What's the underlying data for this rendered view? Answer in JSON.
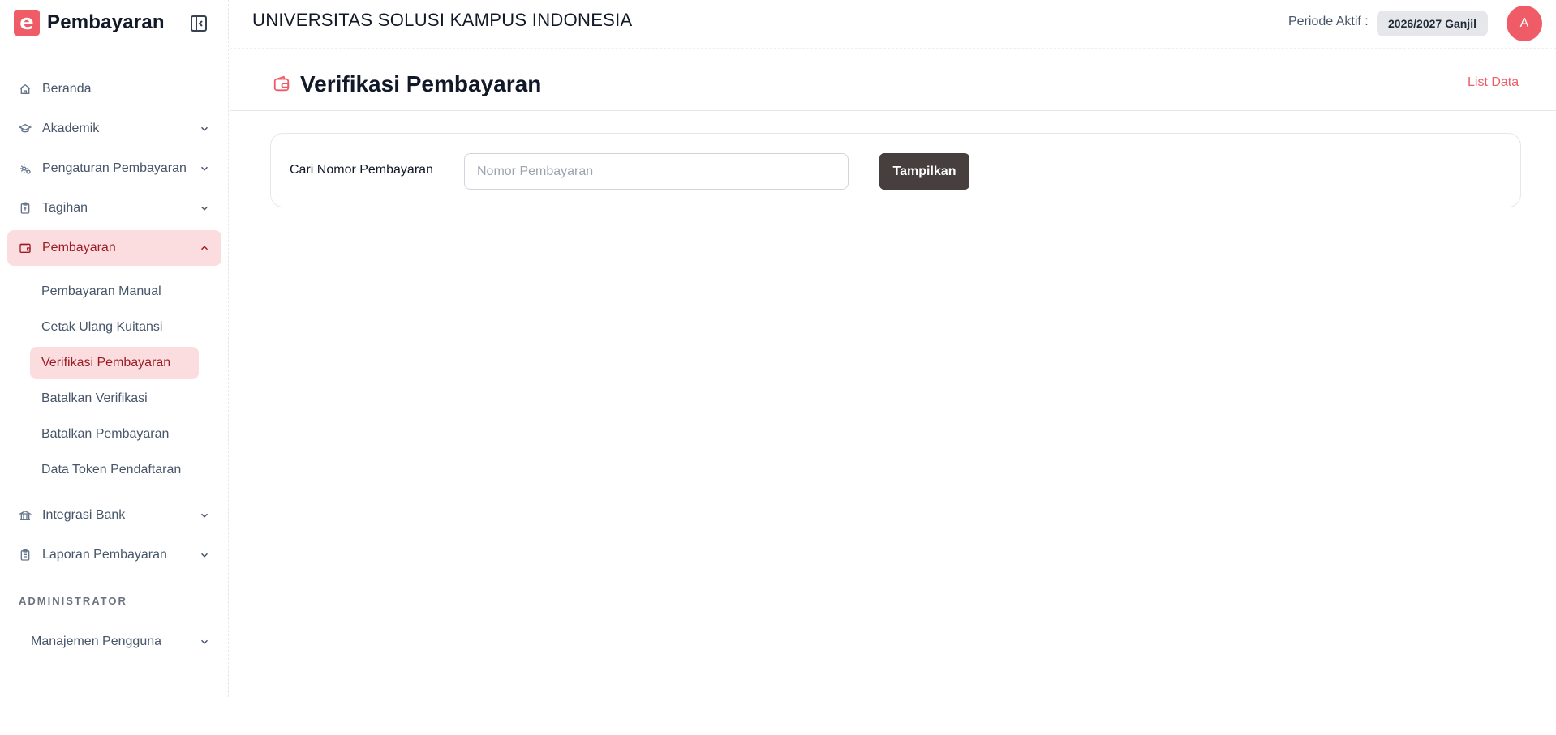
{
  "app": {
    "title": "Pembayaran",
    "logo_letter": "e"
  },
  "topbar": {
    "university": "UNIVERSITAS SOLUSI KAMPUS INDONESIA",
    "periode_label": "Periode Aktif :",
    "periode_value": "2026/2027 Ganjil",
    "avatar_initial": "A"
  },
  "sidebar": {
    "items": [
      {
        "label": "Beranda",
        "icon": "home-icon"
      },
      {
        "label": "Akademik",
        "icon": "graduation-cap-icon"
      },
      {
        "label": "Pengaturan Pembayaran",
        "icon": "settings-payment-icon"
      },
      {
        "label": "Tagihan",
        "icon": "clipboard-icon"
      },
      {
        "label": "Pembayaran",
        "icon": "wallet-icon",
        "active": true
      }
    ],
    "sub_items": [
      {
        "label": "Pembayaran Manual"
      },
      {
        "label": "Cetak Ulang Kuitansi"
      },
      {
        "label": "Verifikasi Pembayaran",
        "active": true
      },
      {
        "label": "Batalkan Verifikasi"
      },
      {
        "label": "Batalkan Pembayaran"
      },
      {
        "label": "Data Token Pendaftaran"
      }
    ],
    "items_after": [
      {
        "label": "Integrasi Bank",
        "icon": "bank-icon"
      },
      {
        "label": "Laporan Pembayaran",
        "icon": "report-icon"
      }
    ],
    "admin_section": "ADMINISTRATOR",
    "admin_items": [
      {
        "label": "Manajemen Pengguna"
      }
    ]
  },
  "page": {
    "title": "Verifikasi Pembayaran",
    "list_data_link": "List Data"
  },
  "search": {
    "label": "Cari Nomor Pembayaran",
    "placeholder": "Nomor Pembayaran",
    "value": "",
    "button_label": "Tampilkan"
  },
  "colors": {
    "accent": "#ef5b66",
    "active_bg": "#fbdde0",
    "active_text": "#9b1c24",
    "button_dark": "#463f3d"
  }
}
